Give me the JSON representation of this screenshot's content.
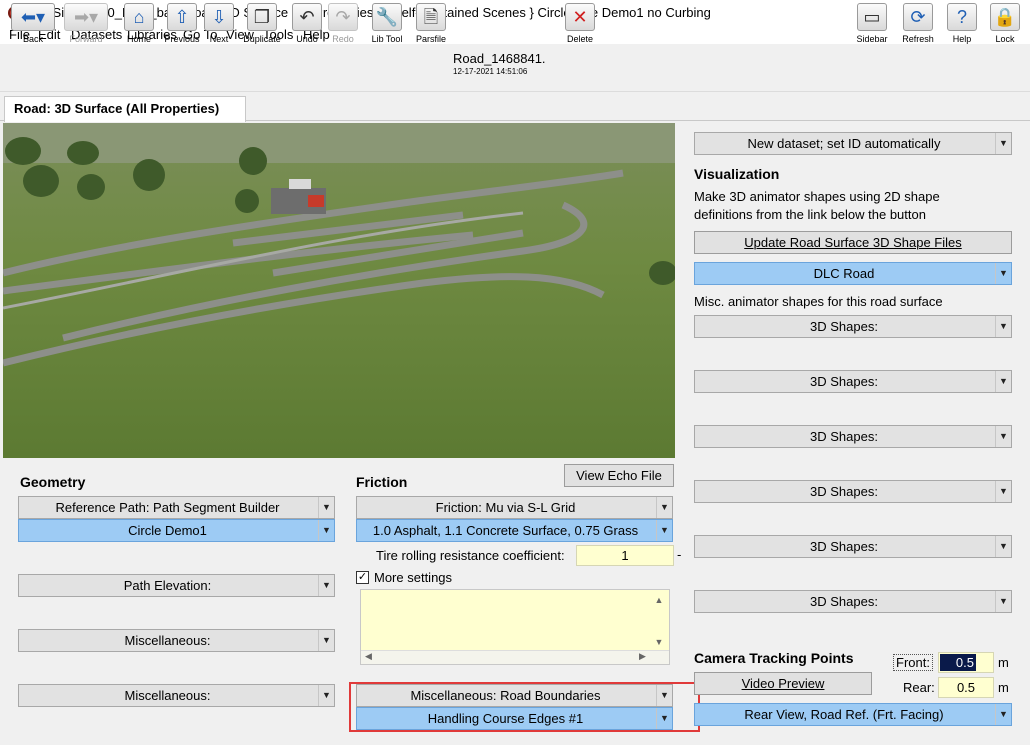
{
  "window": {
    "title": "[CarSim2019.0_Data_bak] Road: 3D Surface (All Properties); { Self-Contained Scenes } Circle Live Demo1 no Curbing",
    "minimize": "—",
    "maximize": "☐",
    "close": "✕"
  },
  "menu": [
    "File",
    "Edit",
    "Datasets",
    "Libraries",
    "Go To",
    "View",
    "Tools",
    "Help"
  ],
  "toolbar": {
    "back": "Back",
    "forward": "Forward",
    "home": "Home",
    "previous": "Previous",
    "next": "Next",
    "duplicate": "Duplicate",
    "undo": "Undo",
    "redo": "Redo",
    "libtool": "Lib Tool",
    "parsfile": "Parsfile",
    "delete": "Delete",
    "sidebar": "Sidebar",
    "refresh": "Refresh",
    "help": "Help",
    "lock": "Lock",
    "dataset_name": "Road_1468841.",
    "dataset_date": "12-17-2021 14:51:06"
  },
  "tab": {
    "label": "Road: 3D Surface (All Properties)"
  },
  "geometry": {
    "header": "Geometry",
    "ref_path": "Reference Path: Path Segment Builder",
    "ref_path_value": "Circle Demo1",
    "path_elevation": "Path Elevation:",
    "misc1": "Miscellaneous:",
    "misc2": "Miscellaneous:"
  },
  "friction": {
    "echo_button": "View Echo File",
    "header": "Friction",
    "mu": "Friction: Mu via S-L Grid",
    "mu_value": "1.0 Asphalt, 1.1 Concrete Surface, 0.75 Grass",
    "tire_label": "Tire rolling resistance coefficient:",
    "tire_value": "1",
    "tire_dash": "-",
    "more_settings": "More settings",
    "more_settings_checked": true,
    "road_boundaries": "Miscellaneous: Road Boundaries",
    "road_boundaries_value": "Handling Course Edges #1"
  },
  "right": {
    "new_dataset": "New dataset; set ID automatically",
    "viz_header": "Visualization",
    "viz_text1": "Make 3D animator shapes using 2D shape",
    "viz_text2": "definitions from the link below the button",
    "update_button": "Update Road Surface 3D Shape Files",
    "dlc": "DLC Road",
    "misc_text": "Misc. animator shapes for this road surface",
    "shapes": [
      "3D Shapes:",
      "3D Shapes:",
      "3D Shapes:",
      "3D Shapes:",
      "3D Shapes:",
      "3D Shapes:"
    ]
  },
  "camera": {
    "header": "Camera Tracking Points",
    "video_button": "Video Preview",
    "front_label": "Front:",
    "front_value": "0.5",
    "rear_label": "Rear:",
    "rear_value": "0.5",
    "unit": "m",
    "view": "Rear View, Road Ref. (Frt. Facing)"
  },
  "colors": {
    "accent_blue": "#9dcbf4",
    "highlight_red": "#e03a3a",
    "field_yellow": "#ffffd0"
  }
}
